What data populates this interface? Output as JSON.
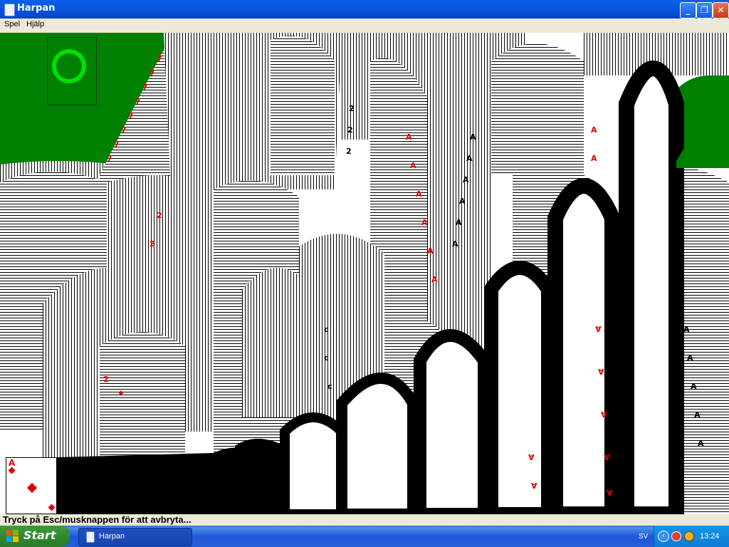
{
  "window": {
    "title": "Harpan",
    "minimize_label": "_",
    "maximize_label": "❐",
    "close_label": "✕"
  },
  "menu": {
    "items": [
      "Spel",
      "Hjälp"
    ]
  },
  "game": {
    "table_color": "#008000",
    "foundation_marker_color": "#00e000",
    "card": {
      "rank": "A",
      "suit": "diamond",
      "suit_color": "#e00000"
    }
  },
  "status": {
    "text": "Tryck på Esc/musknappen för att avbryta..."
  },
  "taskbar": {
    "start_label": "Start",
    "task_label": "Harpan",
    "language": "SV",
    "clock": "13:24",
    "tray_icons": [
      "back-arrow-icon",
      "security-icon",
      "network-icon"
    ]
  }
}
